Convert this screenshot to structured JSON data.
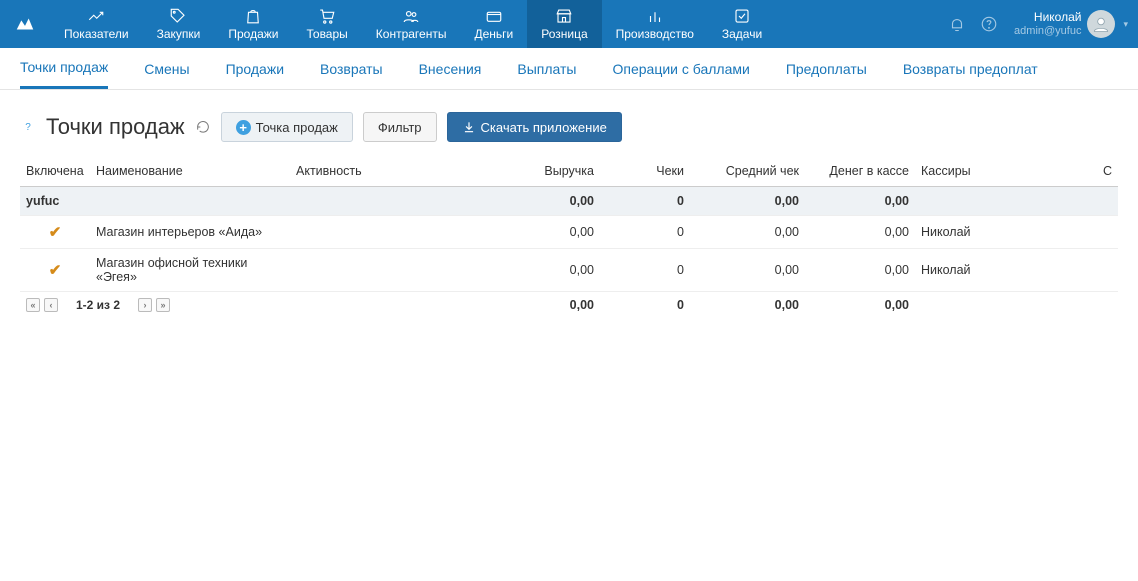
{
  "topnav": {
    "items": [
      {
        "label": "Показатели"
      },
      {
        "label": "Закупки"
      },
      {
        "label": "Продажи"
      },
      {
        "label": "Товары"
      },
      {
        "label": "Контрагенты"
      },
      {
        "label": "Деньги"
      },
      {
        "label": "Розница"
      },
      {
        "label": "Производство"
      },
      {
        "label": "Задачи"
      }
    ]
  },
  "user": {
    "name": "Николай",
    "sub": "admin@yufuc"
  },
  "subnav": {
    "items": [
      {
        "label": "Точки продаж"
      },
      {
        "label": "Смены"
      },
      {
        "label": "Продажи"
      },
      {
        "label": "Возвраты"
      },
      {
        "label": "Внесения"
      },
      {
        "label": "Выплаты"
      },
      {
        "label": "Операции с баллами"
      },
      {
        "label": "Предоплаты"
      },
      {
        "label": "Возвраты предоплат"
      }
    ]
  },
  "page": {
    "title": "Точки продаж",
    "addBtn": "Точка продаж",
    "filterBtn": "Фильтр",
    "downloadBtn": "Скачать приложение"
  },
  "table": {
    "headers": {
      "enabled": "Включена",
      "name": "Наименование",
      "activity": "Активность",
      "revenue": "Выручка",
      "checks": "Чеки",
      "avg": "Средний чек",
      "cash": "Денег в кассе",
      "cashiers": "Кассиры",
      "last": "С"
    },
    "group": {
      "name": "yufuc",
      "revenue": "0,00",
      "checks": "0",
      "avg": "0,00",
      "cash": "0,00"
    },
    "rows": [
      {
        "name": "Магазин интерьеров «Аида»",
        "revenue": "0,00",
        "checks": "0",
        "avg": "0,00",
        "cash": "0,00",
        "cashiers": "Николай"
      },
      {
        "name": "Магазин офисной техники «Эгея»",
        "revenue": "0,00",
        "checks": "0",
        "avg": "0,00",
        "cash": "0,00",
        "cashiers": "Николай"
      }
    ],
    "footer": {
      "revenue": "0,00",
      "checks": "0",
      "avg": "0,00",
      "cash": "0,00"
    },
    "pager": "1-2 из 2"
  }
}
